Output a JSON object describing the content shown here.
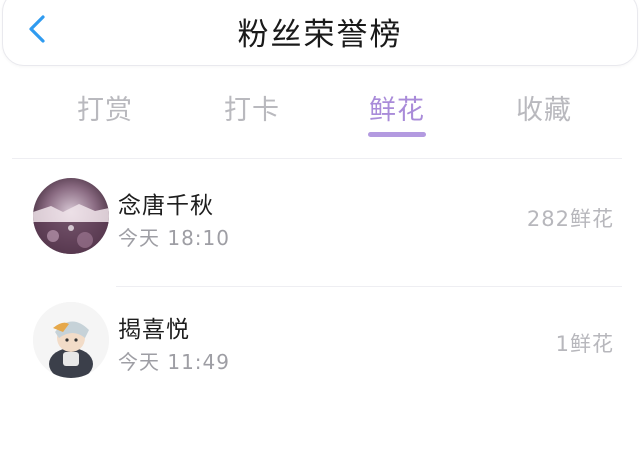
{
  "header": {
    "title": "粉丝荣誉榜",
    "back_icon": "chevron-left-icon",
    "accent_color": "#2f9bf0"
  },
  "tabs": [
    {
      "label": "打赏",
      "active": false
    },
    {
      "label": "打卡",
      "active": false
    },
    {
      "label": "鲜花",
      "active": true
    },
    {
      "label": "收藏",
      "active": false
    }
  ],
  "active_color": "#a98bd9",
  "list": [
    {
      "name": "念唐千秋",
      "time": "今天 18:10",
      "amount": "282鲜花"
    },
    {
      "name": "揭喜悦",
      "time": "今天 11:49",
      "amount": "1鲜花"
    }
  ]
}
